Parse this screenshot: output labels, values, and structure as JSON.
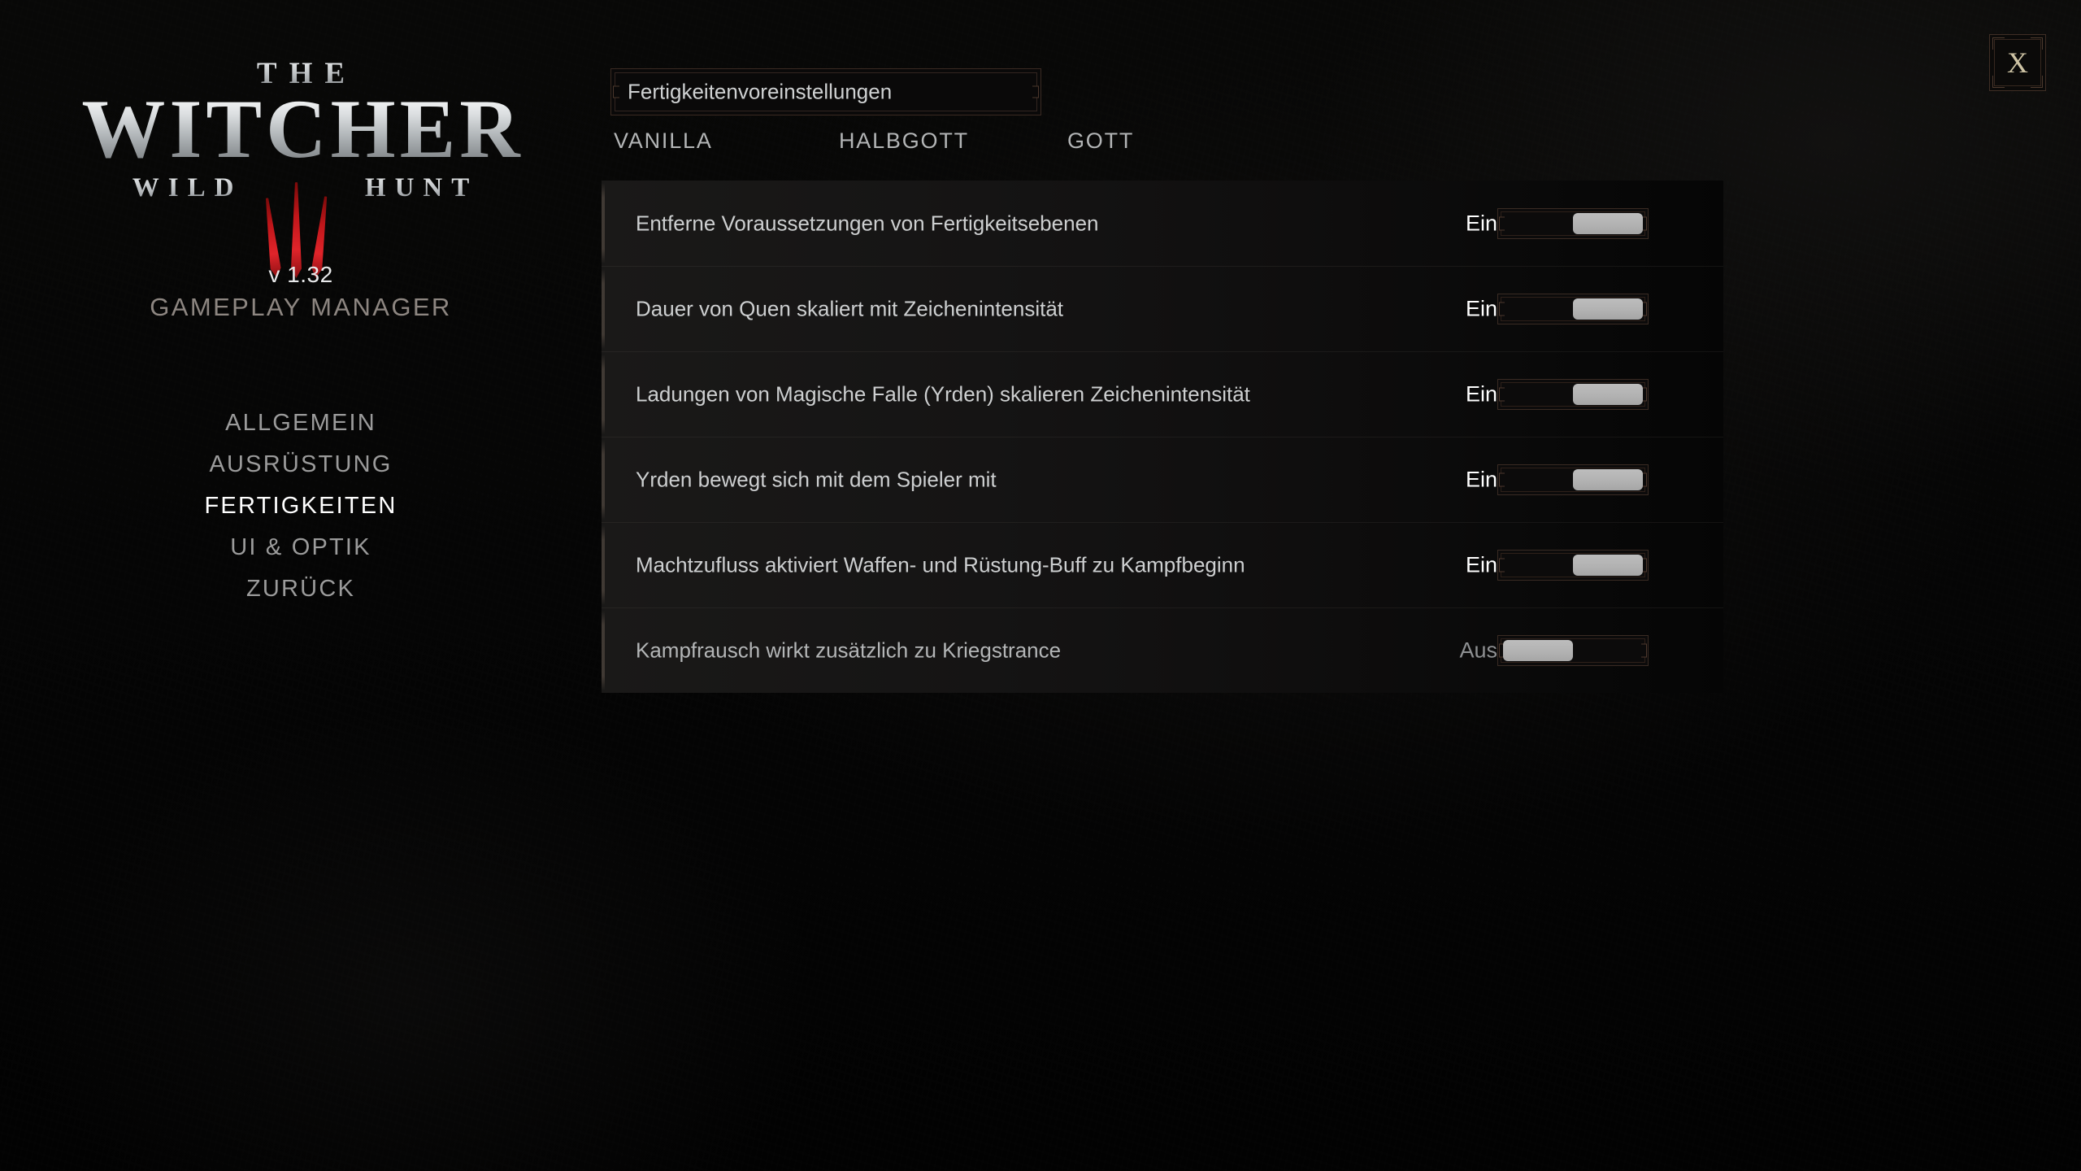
{
  "app": {
    "logo_the": "THE",
    "logo_witcher": "WITCHER",
    "logo_wild": "WILD",
    "logo_hunt": "HUNT",
    "version": "v 1.32",
    "subtitle": "GAMEPLAY MANAGER",
    "accent_border": "#3a2a22",
    "accent_x": "#cdc3a4",
    "knob_color": "#b2b2b2"
  },
  "sidebar": {
    "items": [
      {
        "label": "ALLGEMEIN",
        "active": false
      },
      {
        "label": "AUSRÜSTUNG",
        "active": false
      },
      {
        "label": "FERTIGKEITEN",
        "active": true
      },
      {
        "label": "UI & OPTIK",
        "active": false
      },
      {
        "label": "ZURÜCK",
        "active": false
      }
    ]
  },
  "header": {
    "preset_selector_value": "Fertigkeitenvoreinstellungen",
    "close_label": "X"
  },
  "tabs": [
    {
      "label": "VANILLA"
    },
    {
      "label": "HALBGOTT"
    },
    {
      "label": "GOTT"
    }
  ],
  "settings": {
    "rows": [
      {
        "label": "Entferne Voraussetzungen von Fertigkeitsebenen",
        "state": "Ein",
        "on": true
      },
      {
        "label": "Dauer von Quen skaliert mit Zeichenintensität",
        "state": "Ein",
        "on": true
      },
      {
        "label": "Ladungen von Magische Falle (Yrden) skalieren Zeichenintensität",
        "state": "Ein",
        "on": true
      },
      {
        "label": "Yrden bewegt sich mit dem Spieler mit",
        "state": "Ein",
        "on": true
      },
      {
        "label": "Machtzufluss aktiviert Waffen- und Rüstung-Buff zu Kampfbeginn",
        "state": "Ein",
        "on": true
      },
      {
        "label": "Kampfrausch wirkt zusätzlich zu Kriegstrance",
        "state": "Aus",
        "on": false
      }
    ]
  }
}
